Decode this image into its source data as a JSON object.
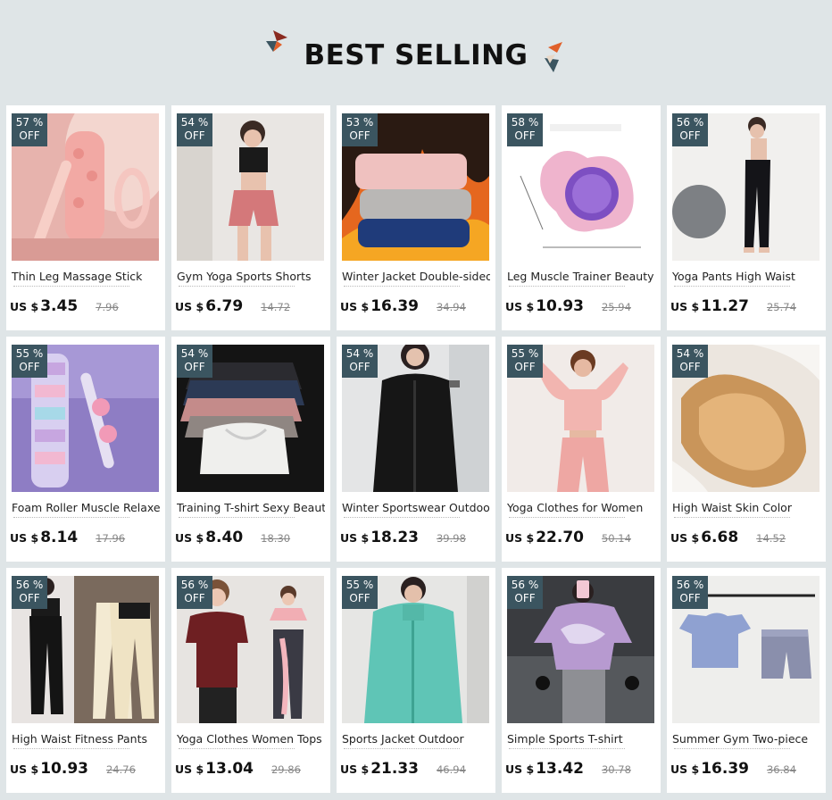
{
  "header": {
    "title": "BEST SELLING"
  },
  "colors": {
    "badge": "#3b5560",
    "accent_orange": "#e0602a",
    "accent_red": "#8a2a20",
    "accent_teal": "#3b5560"
  },
  "products": [
    {
      "discount": "57 %",
      "off": "OFF",
      "name": "Thin Leg Massage Stick",
      "currency": "US $",
      "price": "3.45",
      "old_price": "7.96",
      "image": "pink-foam-roller-set"
    },
    {
      "discount": "54 %",
      "off": "OFF",
      "name": "Gym Yoga Sports Shorts",
      "currency": "US $",
      "price": "6.79",
      "old_price": "14.72",
      "image": "woman-pink-shorts"
    },
    {
      "discount": "53 %",
      "off": "OFF",
      "name": "Winter Jacket Double-sided",
      "currency": "US $",
      "price": "16.39",
      "old_price": "34.94",
      "image": "folded-fleece-jackets-fire"
    },
    {
      "discount": "58 %",
      "off": "OFF",
      "name": "Leg Muscle Trainer Beauty",
      "currency": "US $",
      "price": "10.93",
      "old_price": "25.94",
      "image": "pink-leg-trainer"
    },
    {
      "discount": "56 %",
      "off": "OFF",
      "name": "Yoga Pants High Waist",
      "currency": "US $",
      "price": "11.27",
      "old_price": "25.74",
      "image": "woman-black-leggings"
    },
    {
      "discount": "55 %",
      "off": "OFF",
      "name": "Foam Roller Muscle Relaxer",
      "currency": "US $",
      "price": "8.14",
      "old_price": "17.96",
      "image": "spiky-foam-roller"
    },
    {
      "discount": "54 %",
      "off": "OFF",
      "name": "Training T-shirt Sexy Beauty",
      "currency": "US $",
      "price": "8.40",
      "old_price": "18.30",
      "image": "stack-crop-tops"
    },
    {
      "discount": "54 %",
      "off": "OFF",
      "name": "Winter Sportswear Outdoor",
      "currency": "US $",
      "price": "18.23",
      "old_price": "39.98",
      "image": "woman-black-fleece"
    },
    {
      "discount": "55 %",
      "off": "OFF",
      "name": "Yoga Clothes for Women",
      "currency": "US $",
      "price": "22.70",
      "old_price": "50.14",
      "image": "woman-pink-set"
    },
    {
      "discount": "54 %",
      "off": "OFF",
      "name": "High Waist Skin Color",
      "currency": "US $",
      "price": "6.68",
      "old_price": "14.52",
      "image": "plush-lined-tights"
    },
    {
      "discount": "56 %",
      "off": "OFF",
      "name": "High Waist Fitness Pants",
      "currency": "US $",
      "price": "10.93",
      "old_price": "24.76",
      "image": "fleece-leggings"
    },
    {
      "discount": "56 %",
      "off": "OFF",
      "name": "Yoga Clothes Women Tops",
      "currency": "US $",
      "price": "13.04",
      "old_price": "29.86",
      "image": "women-twist-tops"
    },
    {
      "discount": "55 %",
      "off": "OFF",
      "name": "Sports Jacket Outdoor",
      "currency": "US $",
      "price": "21.33",
      "old_price": "46.94",
      "image": "woman-teal-fleece"
    },
    {
      "discount": "56 %",
      "off": "OFF",
      "name": "Simple Sports T-shirt",
      "currency": "US $",
      "price": "13.42",
      "old_price": "30.78",
      "image": "woman-tie-dye-top"
    },
    {
      "discount": "56 %",
      "off": "OFF",
      "name": "Summer Gym Two-piece",
      "currency": "US $",
      "price": "16.39",
      "old_price": "36.84",
      "image": "blue-tee-shorts-set"
    }
  ]
}
